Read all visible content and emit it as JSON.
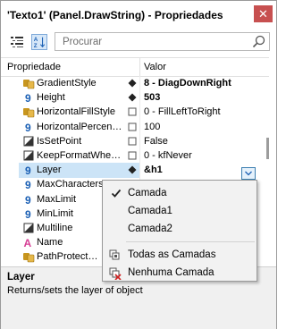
{
  "window": {
    "title": "'Texto1' (Panel.DrawString) - Propriedades",
    "close_glyph": "✕"
  },
  "toolbar": {
    "search_placeholder": "Procurar"
  },
  "grid": {
    "header_property": "Propriedade",
    "header_value": "Valor",
    "rows": [
      {
        "icon": "group-icon",
        "name": "GradientStyle",
        "marker": "diamond",
        "value": "8 - DiagDownRight",
        "bold": true,
        "selected": false
      },
      {
        "icon": "number-icon",
        "name": "Height",
        "marker": "diamond",
        "value": "503",
        "bold": true,
        "selected": false
      },
      {
        "icon": "group-icon",
        "name": "HorizontalFillStyle",
        "marker": "box",
        "value": "0 - FillLeftToRight",
        "bold": false,
        "selected": false
      },
      {
        "icon": "number-icon",
        "name": "HorizontalPercen…",
        "marker": "box",
        "value": "100",
        "bold": false,
        "selected": false
      },
      {
        "icon": "bool-icon",
        "name": "IsSetPoint",
        "marker": "box",
        "value": "False",
        "bold": false,
        "selected": false
      },
      {
        "icon": "bool-icon",
        "name": "KeepFormatWhe…",
        "marker": "box",
        "value": "0 - kfNever",
        "bold": false,
        "selected": false
      },
      {
        "icon": "number-icon",
        "name": "Layer",
        "marker": "diamond",
        "value": "&h1",
        "bold": true,
        "selected": true
      },
      {
        "icon": "number-icon",
        "name": "MaxCharacters",
        "marker": "",
        "value": "",
        "bold": false,
        "selected": false
      },
      {
        "icon": "number-icon",
        "name": "MaxLimit",
        "marker": "",
        "value": "",
        "bold": false,
        "selected": false
      },
      {
        "icon": "number-icon",
        "name": "MinLimit",
        "marker": "",
        "value": "",
        "bold": false,
        "selected": false
      },
      {
        "icon": "bool-icon",
        "name": "Multiline",
        "marker": "",
        "value": "",
        "bold": false,
        "selected": false
      },
      {
        "icon": "text-icon",
        "name": "Name",
        "marker": "",
        "value": "",
        "bold": false,
        "selected": false
      },
      {
        "icon": "group-icon",
        "name": "PathProtect…",
        "marker": "",
        "value": "",
        "bold": false,
        "selected": false
      }
    ]
  },
  "dropdown": {
    "items": [
      {
        "label": "Camada",
        "checked": true
      },
      {
        "label": "Camada1",
        "checked": false
      },
      {
        "label": "Camada2",
        "checked": false
      }
    ],
    "actions": [
      {
        "label": "Todas as Camadas",
        "icon": "layers-all-icon"
      },
      {
        "label": "Nenhuma Camada",
        "icon": "layers-none-icon"
      }
    ]
  },
  "description": {
    "title": "Layer",
    "text": "Returns/sets the layer of object"
  },
  "colors": {
    "selection": "#cce4f7",
    "accent": "#3c7fb1",
    "icon_blue": "#1a5fb4",
    "icon_gold": "#c8961e",
    "icon_pink": "#d63d94",
    "close_red": "#c75050"
  }
}
